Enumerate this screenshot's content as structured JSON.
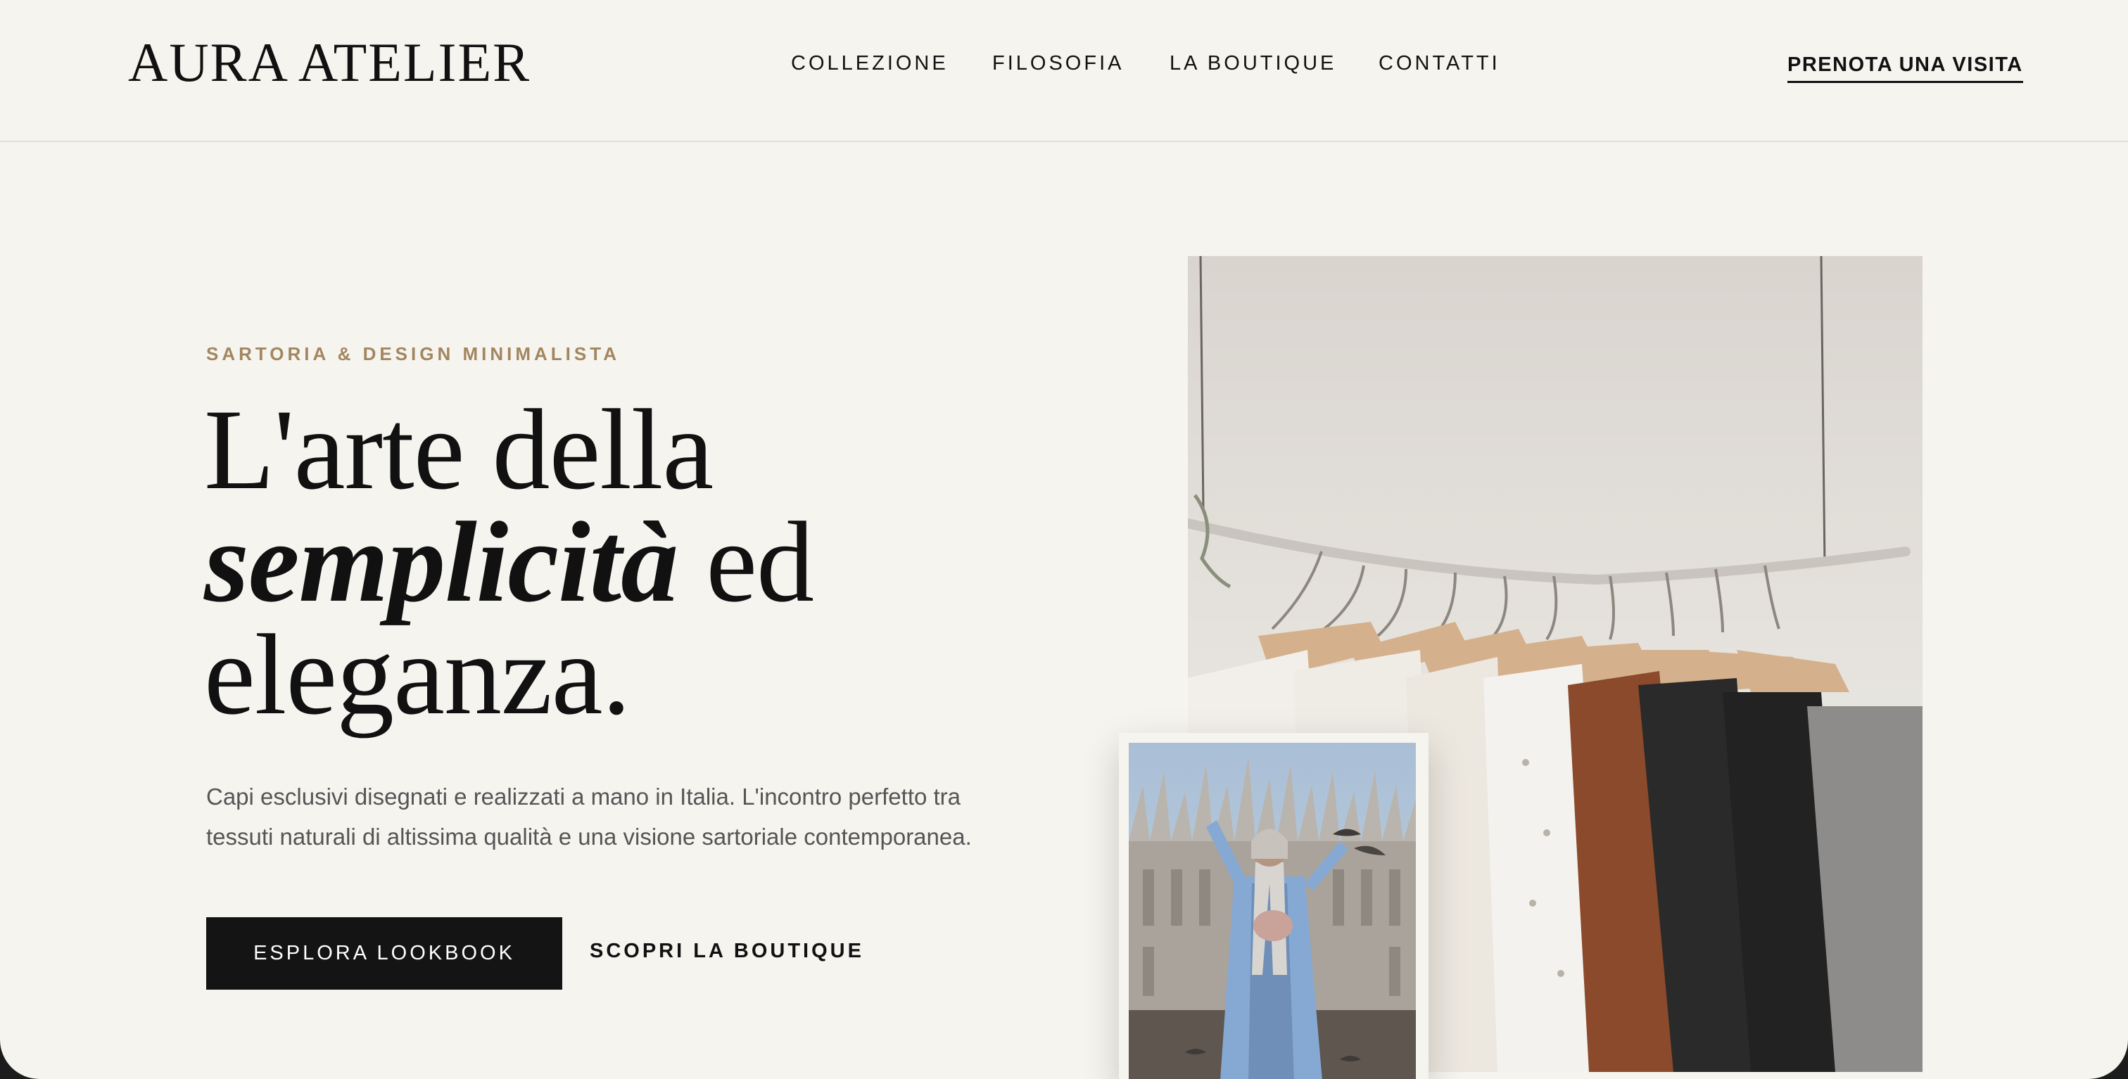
{
  "brand": {
    "logo_text": "AURA ATELIER"
  },
  "nav": {
    "items": [
      {
        "label": "COLLEZIONE"
      },
      {
        "label": "FILOSOFIA"
      },
      {
        "label": "LA BOUTIQUE"
      },
      {
        "label": "CONTATTI"
      }
    ],
    "cta_label": "PRENOTA UNA VISITA"
  },
  "hero": {
    "eyebrow": "SARTORIA & DESIGN MINIMALISTA",
    "headline_part1": "L'arte della",
    "headline_italic": "semplicità",
    "headline_part2": " ed",
    "headline_part3": "eleganza.",
    "lead": "Capi esclusivi disegnati e realizzati a mano in Italia. L'incontro perfetto tra tessuti naturali di altissima qualità e una visione sartoriale contemporanea.",
    "primary_button": "ESPLORA LOOKBOOK",
    "secondary_link": "SCOPRI LA BOUTIQUE"
  },
  "images": {
    "main": "clothes-rack-photo",
    "inset": "duomo-street-style-photo"
  },
  "colors": {
    "background": "#f6f4ef",
    "accent": "#a3865f",
    "text": "#111111",
    "button_bg": "#141414"
  }
}
